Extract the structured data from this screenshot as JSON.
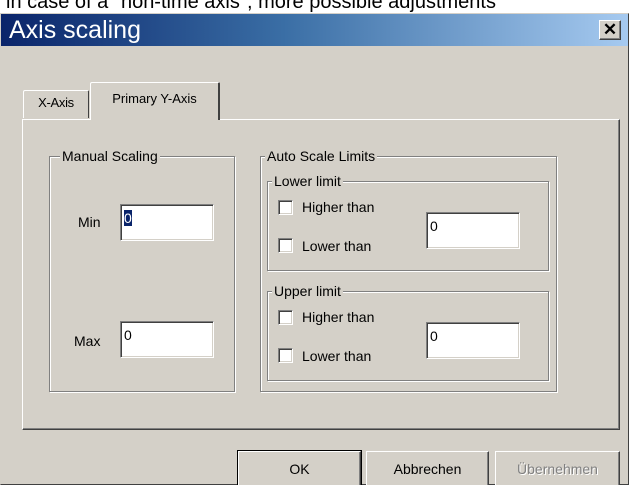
{
  "background_caption": "in case of a \"non-time axis\", more possible adjustments",
  "window": {
    "title": "Axis scaling",
    "close_glyph": "✕"
  },
  "tabs": [
    {
      "label": "X-Axis",
      "active": false
    },
    {
      "label": "Primary Y-Axis",
      "active": true
    }
  ],
  "manual_scaling": {
    "group_label": "Manual Scaling",
    "min_label": "Min",
    "min_value": "0",
    "max_label": "Max",
    "max_value": "0"
  },
  "auto_scale": {
    "group_label": "Auto Scale Limits",
    "lower": {
      "group_label": "Lower limit",
      "higher_than_label": "Higher than",
      "higher_than_checked": false,
      "lower_than_label": "Lower than",
      "lower_than_checked": false,
      "value": "0"
    },
    "upper": {
      "group_label": "Upper limit",
      "higher_than_label": "Higher than",
      "higher_than_checked": false,
      "lower_than_label": "Lower than",
      "lower_than_checked": false,
      "value": "0"
    }
  },
  "buttons": {
    "ok": "OK",
    "cancel": "Abbrechen",
    "apply": "Übernehmen",
    "apply_enabled": false
  },
  "colors": {
    "titlebar_start": "#0a246a",
    "titlebar_end": "#a6caf0",
    "dialog_face": "#d4d0c8"
  }
}
